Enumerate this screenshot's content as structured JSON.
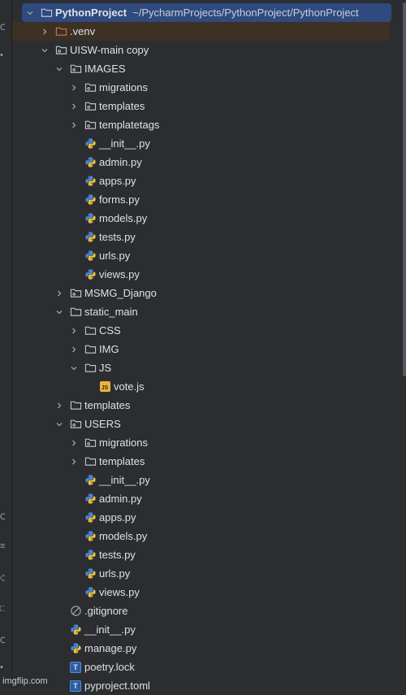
{
  "project": {
    "name": "PythonProject",
    "path": "~/PycharmProjects/PythonProject/PythonProject"
  },
  "tree": [
    {
      "label": "PythonProject",
      "path": "~/PycharmProjects/PythonProject/PythonProject",
      "depth": 0,
      "chevron": "down",
      "icon": "folder",
      "selected": true
    },
    {
      "label": ".venv",
      "depth": 1,
      "chevron": "right",
      "icon": "folder-excluded",
      "excluded": true
    },
    {
      "label": "UISW-main copy",
      "depth": 1,
      "chevron": "down",
      "icon": "package"
    },
    {
      "label": "IMAGES",
      "depth": 2,
      "chevron": "down",
      "icon": "package"
    },
    {
      "label": "migrations",
      "depth": 3,
      "chevron": "right",
      "icon": "package"
    },
    {
      "label": "templates",
      "depth": 3,
      "chevron": "right",
      "icon": "package"
    },
    {
      "label": "templatetags",
      "depth": 3,
      "chevron": "right",
      "icon": "package"
    },
    {
      "label": "__init__.py",
      "depth": 3,
      "chevron": "none",
      "icon": "python"
    },
    {
      "label": "admin.py",
      "depth": 3,
      "chevron": "none",
      "icon": "python"
    },
    {
      "label": "apps.py",
      "depth": 3,
      "chevron": "none",
      "icon": "python"
    },
    {
      "label": "forms.py",
      "depth": 3,
      "chevron": "none",
      "icon": "python"
    },
    {
      "label": "models.py",
      "depth": 3,
      "chevron": "none",
      "icon": "python"
    },
    {
      "label": "tests.py",
      "depth": 3,
      "chevron": "none",
      "icon": "python"
    },
    {
      "label": "urls.py",
      "depth": 3,
      "chevron": "none",
      "icon": "python"
    },
    {
      "label": "views.py",
      "depth": 3,
      "chevron": "none",
      "icon": "python"
    },
    {
      "label": "MSMG_Django",
      "depth": 2,
      "chevron": "right",
      "icon": "package"
    },
    {
      "label": "static_main",
      "depth": 2,
      "chevron": "down",
      "icon": "folder"
    },
    {
      "label": "CSS",
      "depth": 3,
      "chevron": "right",
      "icon": "folder"
    },
    {
      "label": "IMG",
      "depth": 3,
      "chevron": "right",
      "icon": "folder"
    },
    {
      "label": "JS",
      "depth": 3,
      "chevron": "down",
      "icon": "folder"
    },
    {
      "label": "vote.js",
      "depth": 4,
      "chevron": "none",
      "icon": "js"
    },
    {
      "label": "templates",
      "depth": 2,
      "chevron": "right",
      "icon": "folder"
    },
    {
      "label": "USERS",
      "depth": 2,
      "chevron": "down",
      "icon": "package"
    },
    {
      "label": "migrations",
      "depth": 3,
      "chevron": "right",
      "icon": "package"
    },
    {
      "label": "templates",
      "depth": 3,
      "chevron": "right",
      "icon": "folder"
    },
    {
      "label": "__init__.py",
      "depth": 3,
      "chevron": "none",
      "icon": "python"
    },
    {
      "label": "admin.py",
      "depth": 3,
      "chevron": "none",
      "icon": "python"
    },
    {
      "label": "apps.py",
      "depth": 3,
      "chevron": "none",
      "icon": "python"
    },
    {
      "label": "models.py",
      "depth": 3,
      "chevron": "none",
      "icon": "python"
    },
    {
      "label": "tests.py",
      "depth": 3,
      "chevron": "none",
      "icon": "python"
    },
    {
      "label": "urls.py",
      "depth": 3,
      "chevron": "none",
      "icon": "python"
    },
    {
      "label": "views.py",
      "depth": 3,
      "chevron": "none",
      "icon": "python"
    },
    {
      "label": ".gitignore",
      "depth": 2,
      "chevron": "none",
      "icon": "ignore"
    },
    {
      "label": "__init__.py",
      "depth": 2,
      "chevron": "none",
      "icon": "python"
    },
    {
      "label": "manage.py",
      "depth": 2,
      "chevron": "none",
      "icon": "python"
    },
    {
      "label": "poetry.lock",
      "depth": 2,
      "chevron": "none",
      "icon": "text"
    },
    {
      "label": "pyproject.toml",
      "depth": 2,
      "chevron": "none",
      "icon": "text"
    }
  ],
  "colors": {
    "background": "#2b2d30",
    "selection": "#2e4a7f",
    "excluded": "#3c3124",
    "text": "#dfe1e5"
  },
  "watermark": "imgflip.com"
}
